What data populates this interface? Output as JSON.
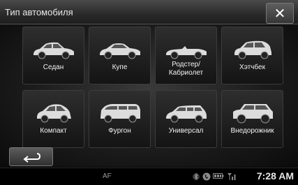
{
  "header": {
    "title": "Тип автомобиля",
    "close_glyph": "✕"
  },
  "car_types": [
    {
      "label": "Седан"
    },
    {
      "label": "Купе"
    },
    {
      "label": "Родстер/\nКабриолет"
    },
    {
      "label": "Хэтчбек"
    },
    {
      "label": "Компакт"
    },
    {
      "label": "Фургон"
    },
    {
      "label": "Универсал"
    },
    {
      "label": "Внедорожник"
    }
  ],
  "status": {
    "af": "AF",
    "time": "7:28 AM"
  },
  "icons": {
    "close": "close-icon",
    "back": "back-arrow-icon",
    "status": [
      "bluetooth-icon",
      "phone-icon",
      "battery-icon",
      "signal-icon"
    ]
  },
  "colors": {
    "tile_label": "#f2f2f2",
    "car_body": "#dcdcdc"
  }
}
